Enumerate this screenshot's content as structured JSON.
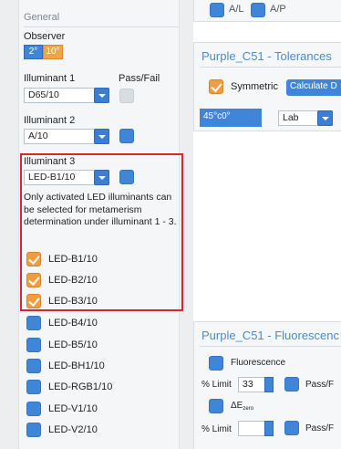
{
  "left": {
    "section_title": "General",
    "observer": {
      "label": "Observer",
      "options": [
        "2°",
        "10°"
      ],
      "selected": "10°"
    },
    "illuminant1": {
      "label": "Illuminant 1",
      "value": "D65/10"
    },
    "pass_fail_label": "Pass/Fail",
    "illuminant2": {
      "label": "Illuminant 2",
      "value": "A/10"
    },
    "illuminant3": {
      "label": "Illuminant 3",
      "value": "LED-B1/10"
    },
    "info_text": "Only activated LED illuminants can be selected for metamerism determination under illuminant 1 - 3.",
    "led_items": [
      {
        "label": "LED-B1/10",
        "checked": true
      },
      {
        "label": "LED-B2/10",
        "checked": true
      },
      {
        "label": "LED-B3/10",
        "checked": true
      },
      {
        "label": "LED-B4/10",
        "checked": false
      },
      {
        "label": "LED-B5/10",
        "checked": false
      },
      {
        "label": "LED-BH1/10",
        "checked": false
      },
      {
        "label": "LED-RGB1/10",
        "checked": false
      },
      {
        "label": "LED-V1/10",
        "checked": false
      },
      {
        "label": "LED-V2/10",
        "checked": false
      }
    ]
  },
  "top_partial": {
    "a": "A/L",
    "b": "A/P"
  },
  "tolerances": {
    "title": "Purple_C51 - Tolerances",
    "symmetric_label": "Symmetric",
    "calc_button": "Calculate D",
    "tab_label": "45°c0°",
    "space_value": "Lab"
  },
  "fluorescence": {
    "title": "Purple_C51 - Fluorescenc",
    "fluorescence_label": "Fluorescence",
    "limit_label": "% Limit",
    "limit_value": "33",
    "passf_label": "Pass/F",
    "de_label": "ΔE",
    "de_sub": "zero",
    "limit2_label": "% Limit",
    "limit2_value": "",
    "passf2_label": "Pass/F"
  }
}
